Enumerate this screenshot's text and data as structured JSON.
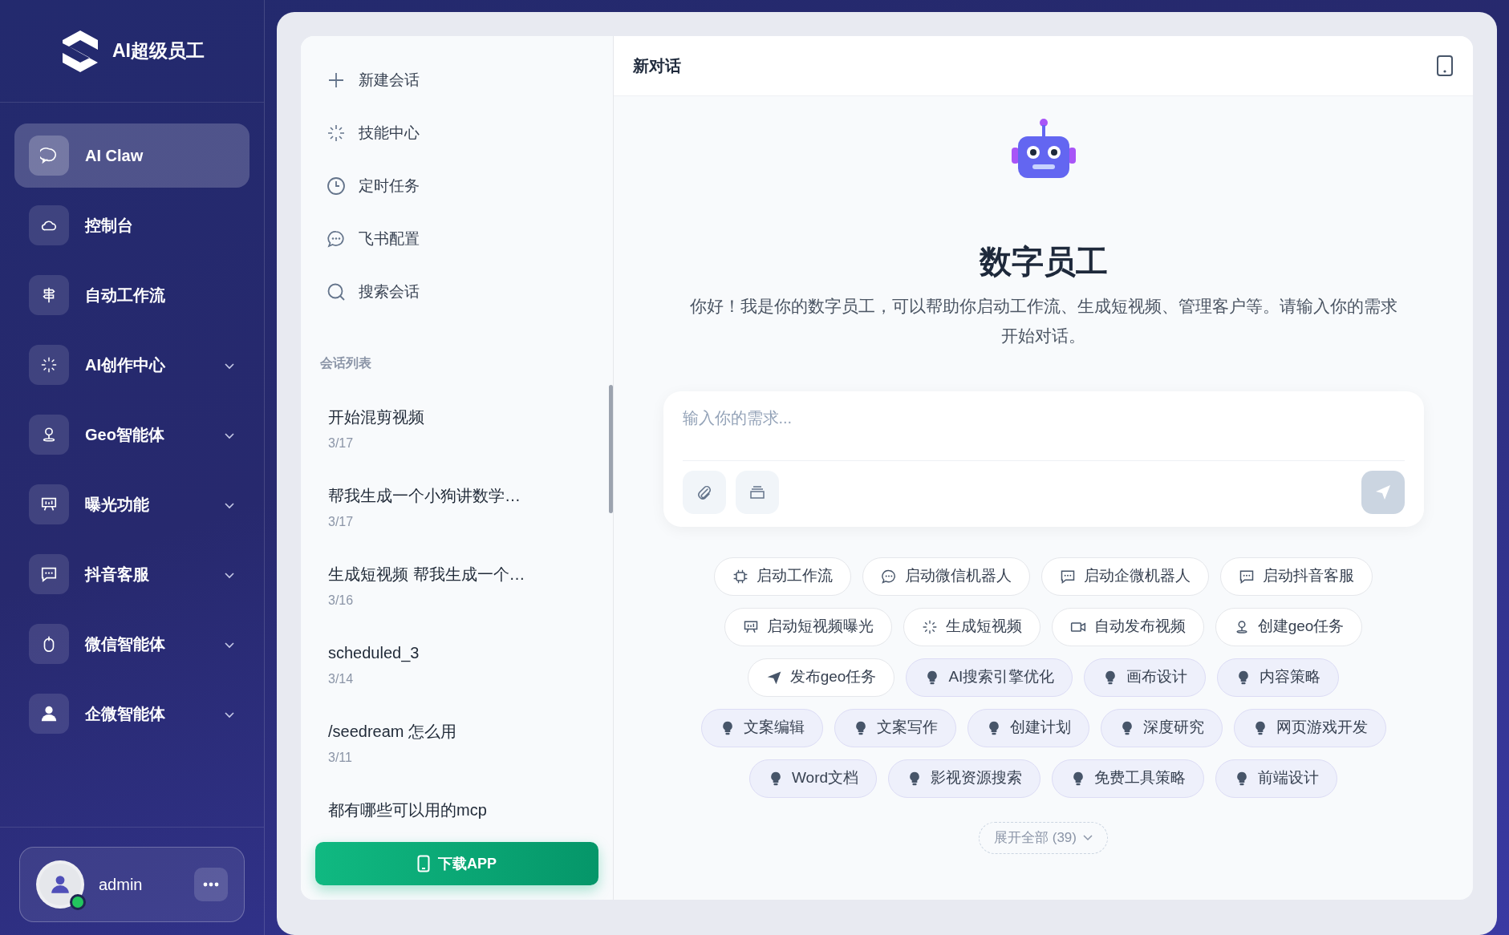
{
  "brand": {
    "name": "AI超级员工"
  },
  "sidebar": {
    "items": [
      {
        "label": "AI Claw",
        "selected": true,
        "expandable": false
      },
      {
        "label": "控制台",
        "selected": false,
        "expandable": false
      },
      {
        "label": "自动工作流",
        "selected": false,
        "expandable": false
      },
      {
        "label": "AI创作中心",
        "selected": false,
        "expandable": true
      },
      {
        "label": "Geo智能体",
        "selected": false,
        "expandable": true
      },
      {
        "label": "曝光功能",
        "selected": false,
        "expandable": true
      },
      {
        "label": "抖音客服",
        "selected": false,
        "expandable": true
      },
      {
        "label": "微信智能体",
        "selected": false,
        "expandable": true
      },
      {
        "label": "企微智能体",
        "selected": false,
        "expandable": true
      }
    ]
  },
  "user": {
    "name": "admin",
    "online": true
  },
  "menu": [
    {
      "label": "新建会话"
    },
    {
      "label": "技能中心"
    },
    {
      "label": "定时任务"
    },
    {
      "label": "飞书配置"
    },
    {
      "label": "搜索会话"
    }
  ],
  "conversation_list": {
    "heading": "会话列表",
    "items": [
      {
        "title": "开始混剪视频",
        "date": "3/17"
      },
      {
        "title": "帮我生成一个小狗讲数学…",
        "date": "3/17"
      },
      {
        "title": "生成短视频 帮我生成一个…",
        "date": "3/16"
      },
      {
        "title": "scheduled_3",
        "date": "3/14"
      },
      {
        "title": "/seedream 怎么用",
        "date": "3/11"
      },
      {
        "title": "都有哪些可以用的mcp"
      }
    ]
  },
  "download_button": "下载APP",
  "chat": {
    "title": "新对话",
    "heading": "数字员工",
    "intro": "你好！我是你的数字员工，可以帮助你启动工作流、生成短视频、管理客户等。请输入你的需求开始对话。",
    "input": {
      "placeholder": "输入你的需求..."
    },
    "chips": [
      {
        "label": "启动工作流",
        "kind": "action"
      },
      {
        "label": "启动微信机器人",
        "kind": "action"
      },
      {
        "label": "启动企微机器人",
        "kind": "action"
      },
      {
        "label": "启动抖音客服",
        "kind": "action"
      },
      {
        "label": "启动短视频曝光",
        "kind": "action"
      },
      {
        "label": "生成短视频",
        "kind": "action"
      },
      {
        "label": "自动发布视频",
        "kind": "action"
      },
      {
        "label": "创建geo任务",
        "kind": "action"
      },
      {
        "label": "发布geo任务",
        "kind": "action"
      },
      {
        "label": "AI搜索引擎优化",
        "kind": "skill"
      },
      {
        "label": "画布设计",
        "kind": "skill"
      },
      {
        "label": "内容策略",
        "kind": "skill"
      },
      {
        "label": "文案编辑",
        "kind": "skill"
      },
      {
        "label": "文案写作",
        "kind": "skill"
      },
      {
        "label": "创建计划",
        "kind": "skill"
      },
      {
        "label": "深度研究",
        "kind": "skill"
      },
      {
        "label": "网页游戏开发",
        "kind": "skill"
      },
      {
        "label": "Word文档",
        "kind": "skill"
      },
      {
        "label": "影视资源搜索",
        "kind": "skill"
      },
      {
        "label": "免费工具策略",
        "kind": "skill"
      },
      {
        "label": "前端设计",
        "kind": "skill"
      }
    ],
    "expand_button": "展开全部 (39)"
  }
}
